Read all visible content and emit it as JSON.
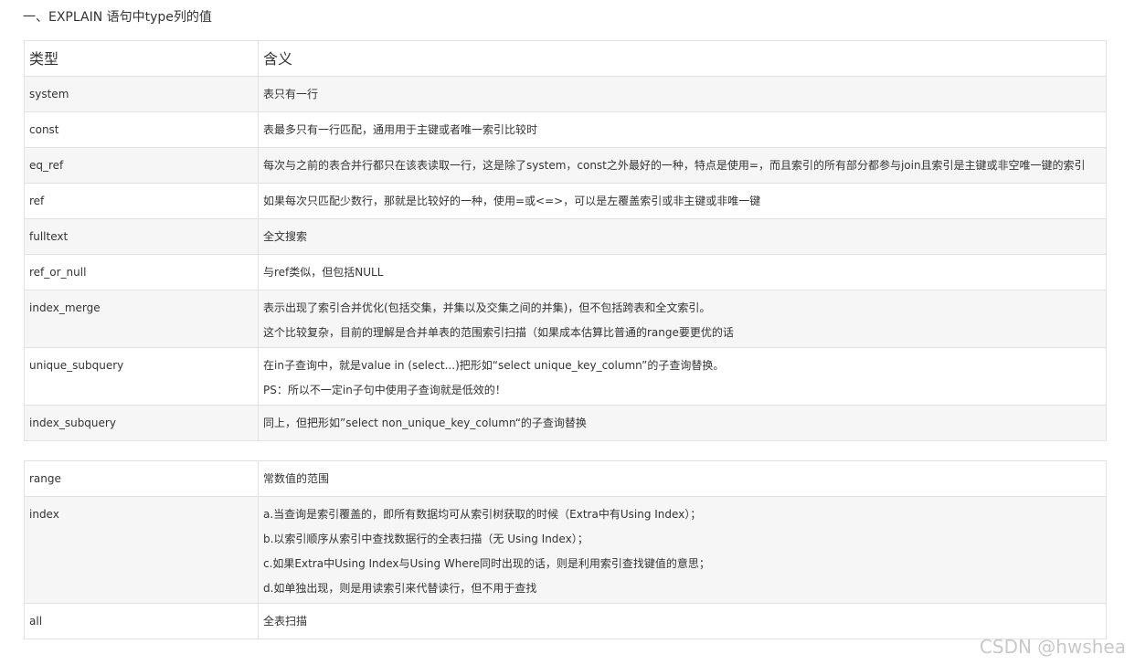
{
  "heading": "一、EXPLAIN 语句中type列的值",
  "table": {
    "headers": [
      "类型",
      "含义"
    ],
    "rows": [
      {
        "type": "system",
        "meaning": [
          "表只有一行"
        ]
      },
      {
        "type": "const",
        "meaning": [
          "表最多只有一行匹配，通用用于主键或者唯一索引比较时"
        ]
      },
      {
        "type": "eq_ref",
        "meaning": [
          "每次与之前的表合并行都只在该表读取一行，这是除了system，const之外最好的一种，特点是使用=，而且索引的所有部分都参与join且索引是主键或非空唯一键的索引"
        ]
      },
      {
        "type": "ref",
        "meaning": [
          "如果每次只匹配少数行，那就是比较好的一种，使用=或<=>，可以是左覆盖索引或非主键或非唯一键"
        ]
      },
      {
        "type": "fulltext",
        "meaning": [
          "全文搜索"
        ]
      },
      {
        "type": "ref_or_null",
        "meaning": [
          "与ref类似，但包括NULL"
        ]
      },
      {
        "type": "index_merge",
        "meaning": [
          "表示出现了索引合并优化(包括交集，并集以及交集之间的并集)，但不包括跨表和全文索引。",
          "这个比较复杂，目前的理解是合并单表的范围索引扫描（如果成本估算比普通的range要更优的话"
        ]
      },
      {
        "type": "unique_subquery",
        "meaning": [
          "在in子查询中，就是value in (select...)把形如“select unique_key_column”的子查询替换。",
          "PS：所以不一定in子句中使用子查询就是低效的！"
        ]
      },
      {
        "type": "index_subquery",
        "meaning": [
          "同上，但把形如”select non_unique_key_column“的子查询替换"
        ]
      }
    ]
  },
  "table2": {
    "rows": [
      {
        "type": "range",
        "meaning": [
          "常数值的范围"
        ]
      },
      {
        "type": "index",
        "meaning": [
          "a.当查询是索引覆盖的，即所有数据均可从索引树获取的时候（Extra中有Using Index）；",
          "b.以索引顺序从索引中查找数据行的全表扫描（无 Using Index）；",
          "c.如果Extra中Using Index与Using Where同时出现的话，则是利用索引查找键值的意思；",
          "d.如单独出现，则是用读索引来代替读行，但不用于查找"
        ]
      },
      {
        "type": "all",
        "meaning": [
          "全表扫描"
        ]
      }
    ]
  },
  "watermark": "CSDN @hwshea"
}
